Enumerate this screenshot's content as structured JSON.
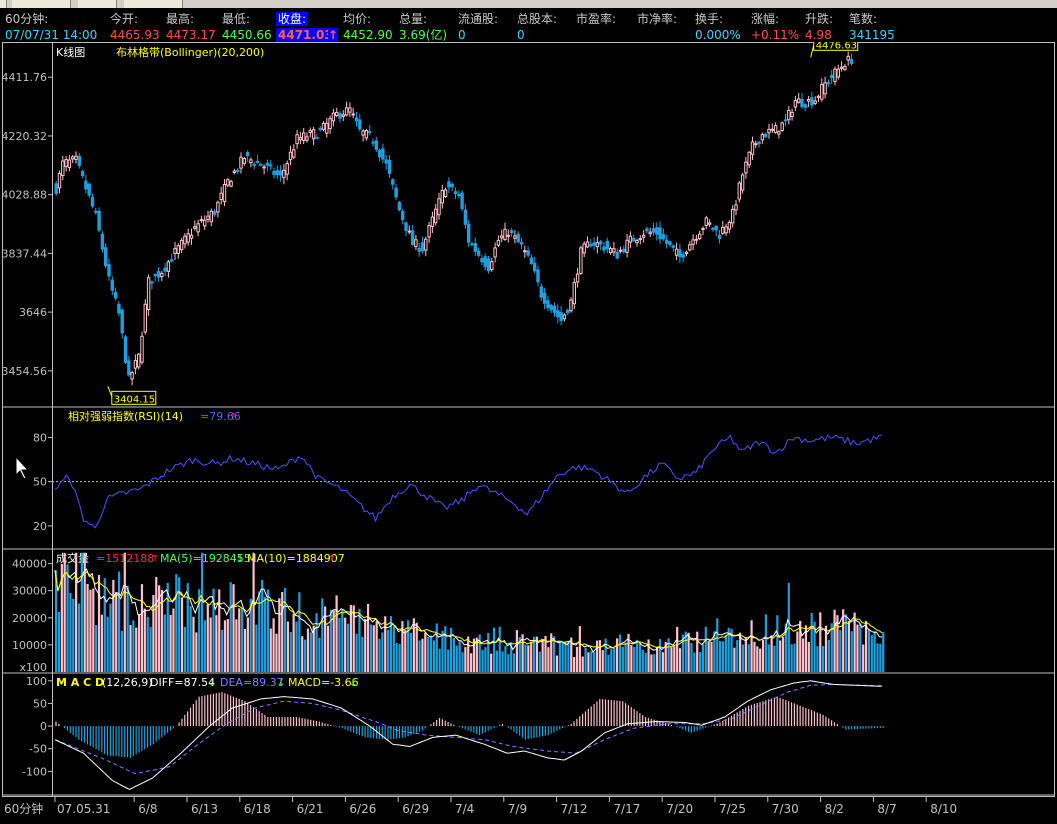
{
  "header": {
    "labels": [
      "60分钟:",
      "今开:",
      "最高:",
      "最低:",
      "收盘:",
      "均价:",
      "总量:",
      "流通股:",
      "总股本:",
      "市盈率:",
      "市净率:",
      "换手:",
      "涨幅:",
      "升跌:",
      "笔数:"
    ],
    "values": [
      "07/07/31 14:00",
      "4465.93",
      "4473.17",
      "4450.66",
      "4471.03",
      "4452.90",
      "3.69(亿)",
      "0",
      "0",
      "",
      "",
      "0.000%",
      "+0.11%",
      "4.98",
      "341195"
    ],
    "close_arrow": "↑"
  },
  "panels": {
    "kline": {
      "title": "K线图",
      "indicator": "布林格带(Bollinger)(20,200)",
      "high_label": "4476.63",
      "low_label": "3404.15"
    },
    "rsi": {
      "title": "相对强弱指数(RSI)(14)",
      "value": "=79.66"
    },
    "volume": {
      "title": "成交量",
      "value": "=1512188",
      "ma5": "MA(5)=1928455",
      "ma10": "MA(10)=1884907",
      "unit": "x100"
    },
    "macd": {
      "title": "M A C D",
      "params": "(12,26,9)",
      "diff": "DIFF=87.54",
      "dea": "DEA=89.37",
      "macd": "MACD=-3.66"
    }
  },
  "axis": {
    "period_label": "60分钟"
  },
  "colors": {
    "up": "#ffc0cb",
    "down": "#1ea0e0",
    "rsi": "#5050ff",
    "ma5": "#ffffff",
    "ma10": "#ffff00",
    "header_up": "#ff5050",
    "header_down": "#50ff50",
    "header_flat": "#40d0ff",
    "label_yellow": "#ffff00"
  },
  "chart_data": [
    {
      "type": "candlestick",
      "title": "K线图",
      "subtitle": "布林格带(Bollinger)(20,200)",
      "ylim": [
        3340,
        4520
      ],
      "yticks": [
        3454.56,
        3646,
        3837.44,
        4028.88,
        4220.32,
        4411.76
      ],
      "ytick_labels": [
        "3454.56",
        "3646",
        "3837.44",
        "4028.88",
        "4220.32",
        "4411.76"
      ],
      "xticks": [
        {
          "label": "07.05.31",
          "pos": 0
        },
        {
          "label": "6/8",
          "pos": 24
        },
        {
          "label": "6/13",
          "pos": 40
        },
        {
          "label": "6/18",
          "pos": 56
        },
        {
          "label": "6/21",
          "pos": 72
        },
        {
          "label": "6/26",
          "pos": 88
        },
        {
          "label": "6/29",
          "pos": 104
        },
        {
          "label": "7/4",
          "pos": 120
        },
        {
          "label": "7/9",
          "pos": 136
        },
        {
          "label": "7/12",
          "pos": 152
        },
        {
          "label": "7/17",
          "pos": 168
        },
        {
          "label": "7/20",
          "pos": 184
        },
        {
          "label": "7/25",
          "pos": 200
        },
        {
          "label": "7/30",
          "pos": 216
        },
        {
          "label": "8/2",
          "pos": 232
        },
        {
          "label": "8/7",
          "pos": 248
        },
        {
          "label": "8/10",
          "pos": 264
        }
      ],
      "max_point": {
        "index": 229,
        "value": 4476.63
      },
      "min_point": {
        "index": 16,
        "value": 3404.15
      },
      "anchors": [
        [
          0,
          4050,
          0
        ],
        [
          2,
          4130,
          0
        ],
        [
          6,
          4140,
          0
        ],
        [
          12,
          3960,
          0
        ],
        [
          16,
          3750,
          0
        ],
        [
          19,
          3640,
          1
        ],
        [
          22,
          3425,
          1
        ],
        [
          25,
          3500,
          0
        ],
        [
          28,
          3745,
          0
        ],
        [
          32,
          3780,
          0
        ],
        [
          36,
          3840,
          0
        ],
        [
          42,
          3920,
          0
        ],
        [
          48,
          3975,
          0
        ],
        [
          52,
          4070,
          0
        ],
        [
          57,
          4150,
          0
        ],
        [
          62,
          4130,
          0
        ],
        [
          68,
          4085,
          0
        ],
        [
          73,
          4210,
          0
        ],
        [
          80,
          4235,
          0
        ],
        [
          85,
          4290,
          0
        ],
        [
          89,
          4305,
          0
        ],
        [
          92,
          4235,
          0
        ],
        [
          96,
          4210,
          0
        ],
        [
          100,
          4125,
          0
        ],
        [
          104,
          3980,
          0
        ],
        [
          108,
          3870,
          0
        ],
        [
          111,
          3855,
          0
        ],
        [
          115,
          3975,
          0
        ],
        [
          118,
          4060,
          0
        ],
        [
          122,
          4025,
          0
        ],
        [
          125,
          3880,
          0
        ],
        [
          128,
          3835,
          0
        ],
        [
          131,
          3795,
          0
        ],
        [
          134,
          3880,
          0
        ],
        [
          137,
          3910,
          0
        ],
        [
          141,
          3860,
          0
        ],
        [
          144,
          3800,
          0
        ],
        [
          147,
          3705,
          0
        ],
        [
          150,
          3660,
          0
        ],
        [
          153,
          3620,
          0
        ],
        [
          156,
          3680,
          0
        ],
        [
          159,
          3840,
          0
        ],
        [
          162,
          3875,
          0
        ],
        [
          166,
          3860,
          0
        ],
        [
          170,
          3835,
          0
        ],
        [
          174,
          3880,
          0
        ],
        [
          178,
          3905,
          0
        ],
        [
          182,
          3905,
          0
        ],
        [
          186,
          3860,
          0
        ],
        [
          189,
          3825,
          0
        ],
        [
          193,
          3885,
          0
        ],
        [
          197,
          3940,
          0
        ],
        [
          201,
          3900,
          0
        ],
        [
          205,
          3965,
          0
        ],
        [
          208,
          4095,
          0
        ],
        [
          211,
          4185,
          0
        ],
        [
          214,
          4225,
          0
        ],
        [
          218,
          4240,
          0
        ],
        [
          221,
          4265,
          0
        ],
        [
          224,
          4335,
          0
        ],
        [
          227,
          4330,
          0
        ],
        [
          230,
          4340,
          0
        ],
        [
          233,
          4390,
          0
        ],
        [
          236,
          4425,
          0
        ],
        [
          239,
          4460,
          0
        ],
        [
          241,
          4471,
          0
        ]
      ],
      "anchor_fields": [
        "bar_index",
        "close",
        "unused"
      ],
      "bar_count": 242
    },
    {
      "type": "line",
      "title": "相对强弱指数(RSI)(14)",
      "ylim": [
        5,
        100
      ],
      "yticks": [
        20,
        50,
        80
      ],
      "reference_line": 50,
      "series": [
        {
          "name": "RSI",
          "anchors": [
            [
              0,
              45
            ],
            [
              5,
              54
            ],
            [
              10,
              25
            ],
            [
              14,
              18
            ],
            [
              18,
              38
            ],
            [
              24,
              42
            ],
            [
              30,
              45
            ],
            [
              40,
              58
            ],
            [
              48,
              65
            ],
            [
              56,
              62
            ],
            [
              62,
              66
            ],
            [
              70,
              62
            ],
            [
              78,
              58
            ],
            [
              86,
              68
            ],
            [
              92,
              52
            ],
            [
              100,
              45
            ],
            [
              106,
              35
            ],
            [
              112,
              25
            ],
            [
              118,
              40
            ],
            [
              124,
              48
            ],
            [
              130,
              40
            ],
            [
              136,
              32
            ],
            [
              142,
              37
            ],
            [
              148,
              48
            ],
            [
              154,
              42
            ],
            [
              160,
              36
            ],
            [
              165,
              28
            ],
            [
              170,
              40
            ],
            [
              176,
              55
            ],
            [
              182,
              60
            ],
            [
              188,
              58
            ],
            [
              194,
              50
            ],
            [
              200,
              42
            ],
            [
              206,
              53
            ],
            [
              212,
              62
            ],
            [
              218,
              52
            ],
            [
              224,
              56
            ],
            [
              230,
              72
            ],
            [
              236,
              80
            ],
            [
              240,
              70
            ],
            [
              246,
              77
            ],
            [
              252,
              70
            ],
            [
              258,
              80
            ],
            [
              264,
              78
            ],
            [
              272,
              80
            ],
            [
              280,
              76
            ],
            [
              288,
              80
            ]
          ]
        }
      ]
    },
    {
      "type": "bar",
      "title": "成交量",
      "ylim": [
        0,
        45000
      ],
      "yticks": [
        10000,
        20000,
        30000,
        40000
      ],
      "unit": "x100",
      "series": [
        {
          "name": "MA(5)",
          "value": 1928455
        },
        {
          "name": "MA(10)",
          "value": 1884907
        }
      ],
      "volume_anchors": [
        [
          0,
          32000
        ],
        [
          8,
          38000
        ],
        [
          16,
          29000
        ],
        [
          24,
          26000
        ],
        [
          40,
          25000
        ],
        [
          60,
          27000
        ],
        [
          80,
          22000
        ],
        [
          100,
          20000
        ],
        [
          120,
          15000
        ],
        [
          140,
          12000
        ],
        [
          160,
          11500
        ],
        [
          180,
          9500
        ],
        [
          200,
          8500
        ],
        [
          215,
          9000
        ],
        [
          230,
          14000
        ],
        [
          250,
          15500
        ],
        [
          270,
          17000
        ],
        [
          290,
          15000
        ]
      ]
    },
    {
      "type": "line",
      "title": "M A C D (12,26,9)",
      "ylim": [
        -150,
        115
      ],
      "yticks": [
        -100,
        -50,
        0,
        50,
        100
      ],
      "series": [
        {
          "name": "DIFF",
          "value": 87.54,
          "anchors": [
            [
              0,
              -30
            ],
            [
              10,
              -60
            ],
            [
              20,
              -120
            ],
            [
              26,
              -140
            ],
            [
              34,
              -115
            ],
            [
              44,
              -60
            ],
            [
              54,
              0
            ],
            [
              62,
              40
            ],
            [
              72,
              60
            ],
            [
              80,
              65
            ],
            [
              90,
              60
            ],
            [
              100,
              40
            ],
            [
              110,
              0
            ],
            [
              118,
              -40
            ],
            [
              124,
              -45
            ],
            [
              132,
              -25
            ],
            [
              140,
              -20
            ],
            [
              150,
              -40
            ],
            [
              158,
              -60
            ],
            [
              164,
              -55
            ],
            [
              172,
              -70
            ],
            [
              178,
              -75
            ],
            [
              184,
              -55
            ],
            [
              192,
              -15
            ],
            [
              200,
              5
            ],
            [
              210,
              10
            ],
            [
              220,
              8
            ],
            [
              226,
              2
            ],
            [
              234,
              20
            ],
            [
              242,
              55
            ],
            [
              250,
              80
            ],
            [
              258,
              95
            ],
            [
              264,
              100
            ],
            [
              272,
              92
            ],
            [
              280,
              90
            ],
            [
              288,
              88
            ]
          ]
        },
        {
          "name": "DEA",
          "value": 89.37,
          "anchors": [
            [
              0,
              -30
            ],
            [
              16,
              -70
            ],
            [
              28,
              -105
            ],
            [
              40,
              -90
            ],
            [
              50,
              -40
            ],
            [
              60,
              5
            ],
            [
              70,
              40
            ],
            [
              80,
              55
            ],
            [
              90,
              50
            ],
            [
              100,
              35
            ],
            [
              112,
              10
            ],
            [
              120,
              -10
            ],
            [
              130,
              -20
            ],
            [
              140,
              -25
            ],
            [
              150,
              -30
            ],
            [
              160,
              -45
            ],
            [
              172,
              -55
            ],
            [
              182,
              -60
            ],
            [
              192,
              -30
            ],
            [
              202,
              -5
            ],
            [
              214,
              5
            ],
            [
              226,
              5
            ],
            [
              236,
              15
            ],
            [
              246,
              45
            ],
            [
              256,
              75
            ],
            [
              264,
              90
            ],
            [
              272,
              92
            ],
            [
              288,
              89
            ]
          ]
        }
      ],
      "histogram_anchors": [
        [
          0,
          10
        ],
        [
          8,
          -30
        ],
        [
          18,
          -65
        ],
        [
          26,
          -70
        ],
        [
          34,
          -40
        ],
        [
          42,
          0
        ],
        [
          50,
          65
        ],
        [
          58,
          75
        ],
        [
          66,
          55
        ],
        [
          74,
          20
        ],
        [
          84,
          20
        ],
        [
          92,
          10
        ],
        [
          100,
          -5
        ],
        [
          108,
          -25
        ],
        [
          116,
          -30
        ],
        [
          122,
          -25
        ],
        [
          128,
          -10
        ],
        [
          134,
          18
        ],
        [
          140,
          0
        ],
        [
          148,
          -20
        ],
        [
          156,
          5
        ],
        [
          164,
          -30
        ],
        [
          172,
          -20
        ],
        [
          180,
          5
        ],
        [
          190,
          60
        ],
        [
          198,
          55
        ],
        [
          206,
          20
        ],
        [
          214,
          5
        ],
        [
          222,
          -15
        ],
        [
          232,
          8
        ],
        [
          242,
          45
        ],
        [
          252,
          65
        ],
        [
          260,
          45
        ],
        [
          268,
          25
        ],
        [
          276,
          -8
        ],
        [
          288,
          -4
        ]
      ]
    }
  ]
}
